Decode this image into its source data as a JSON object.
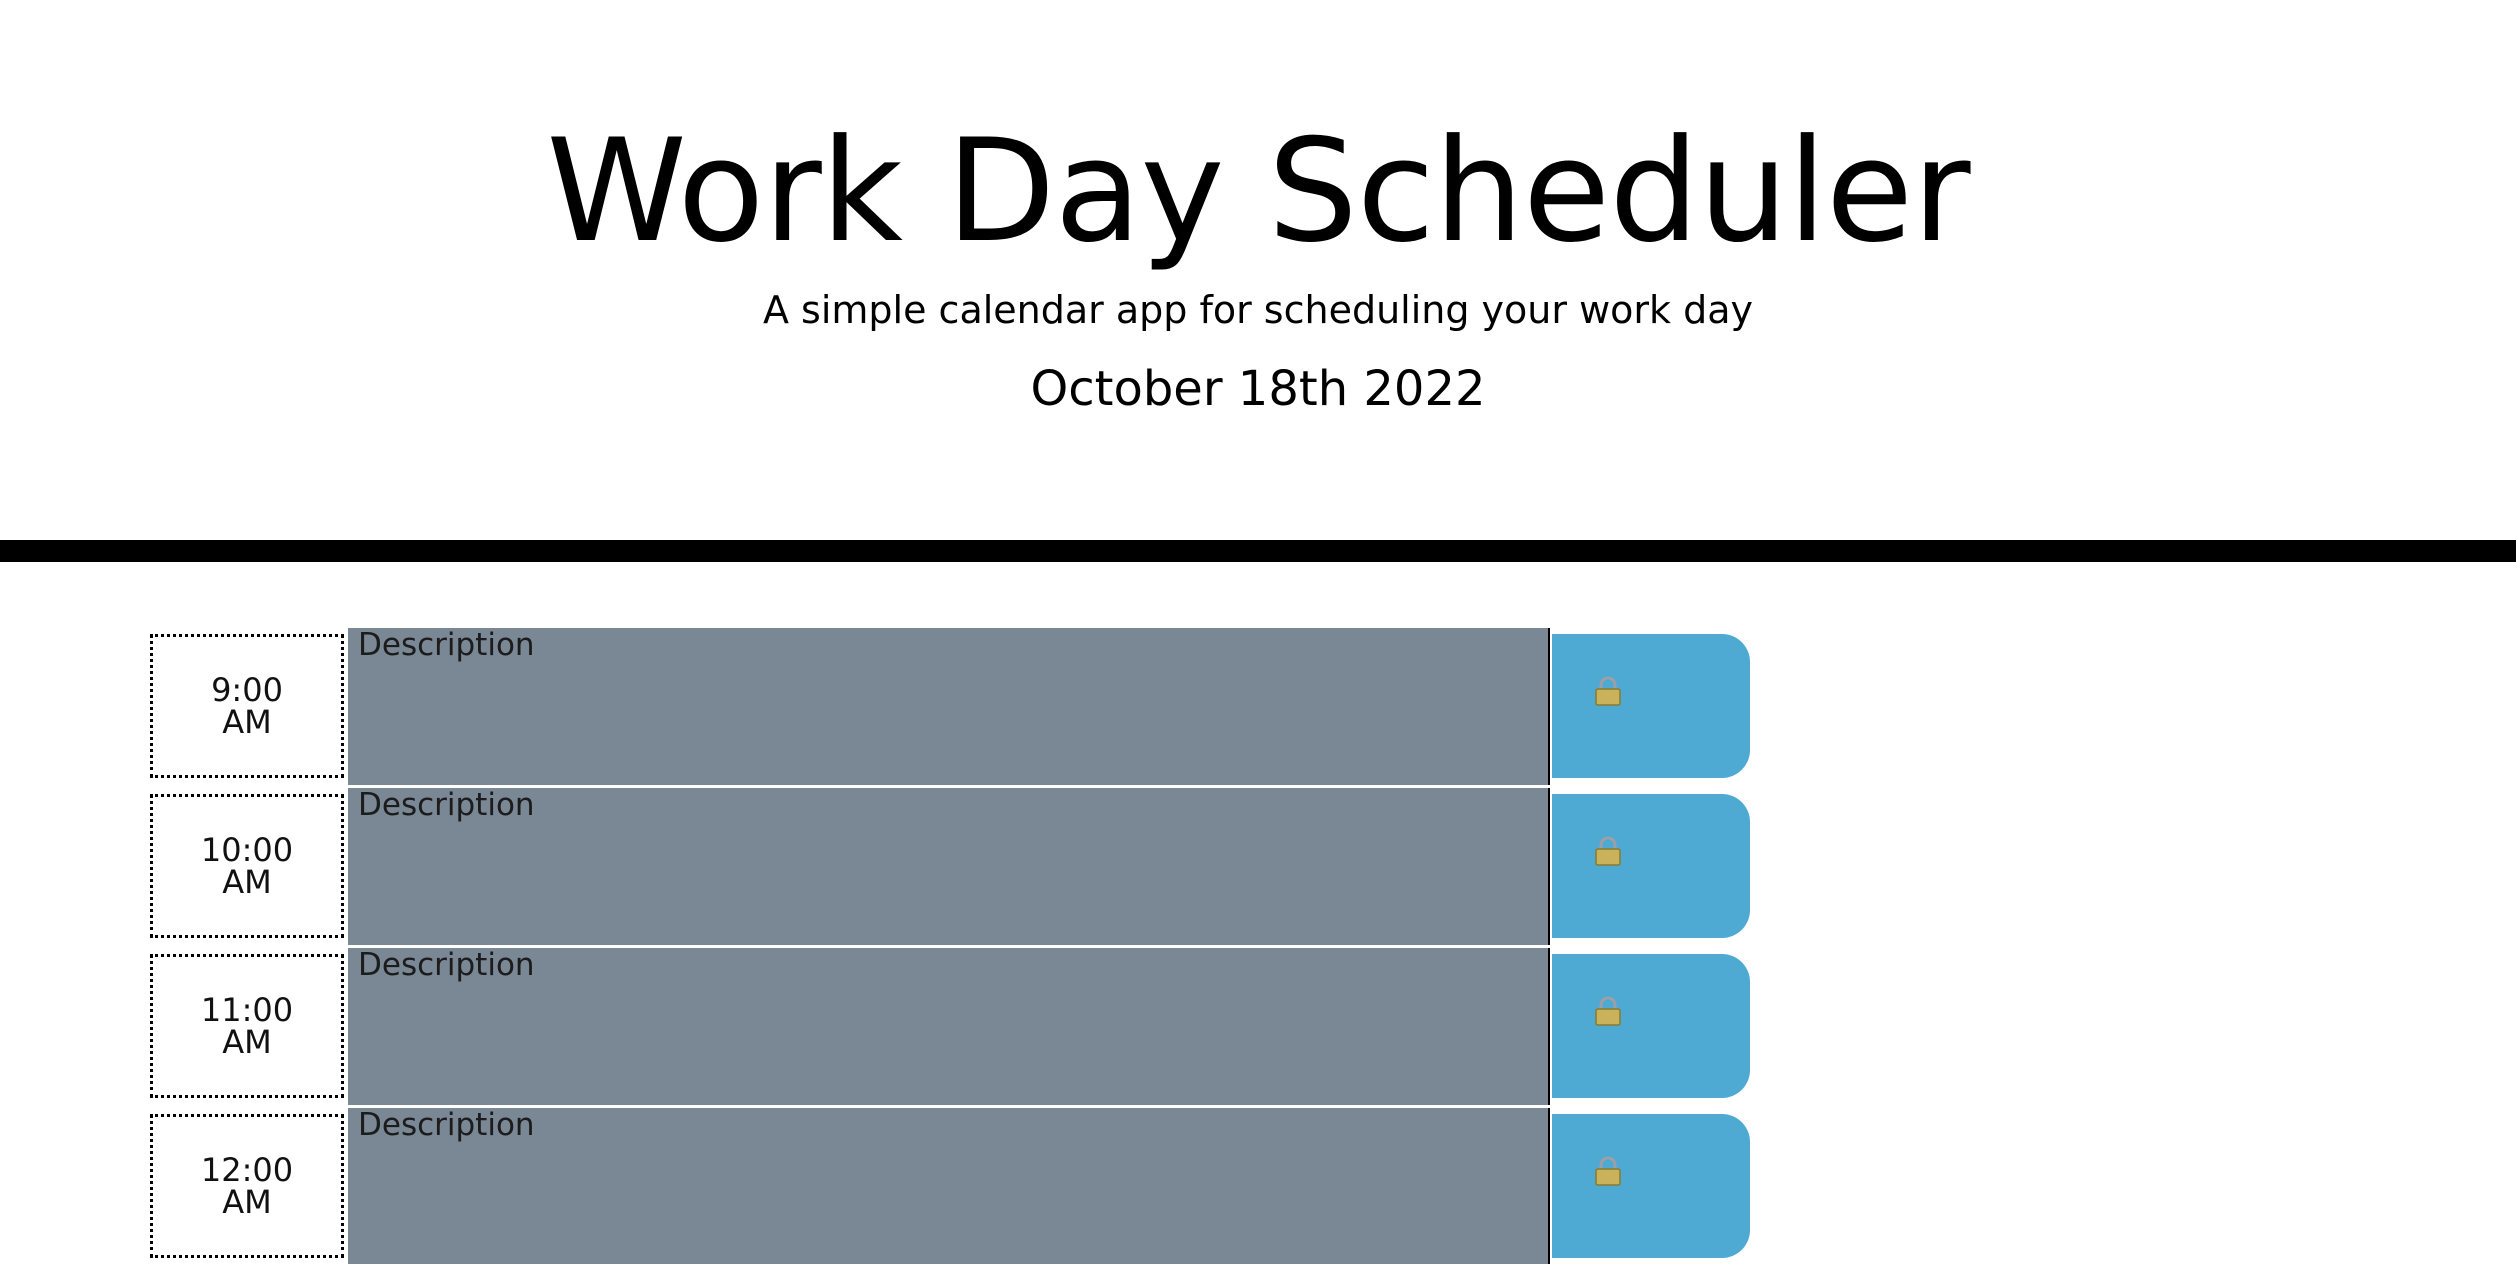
{
  "header": {
    "title": "Work Day Scheduler",
    "subtitle": "A simple calendar app for scheduling your work day",
    "date": "October 18th 2022"
  },
  "rows": [
    {
      "hour": "9:00 AM",
      "description": "",
      "placeholder": "Description",
      "save_icon": "lock-icon"
    },
    {
      "hour": "10:00 AM",
      "description": "",
      "placeholder": "Description",
      "save_icon": "lock-icon"
    },
    {
      "hour": "11:00 AM",
      "description": "",
      "placeholder": "Description",
      "save_icon": "lock-icon"
    },
    {
      "hour": "12:00 AM",
      "description": "",
      "placeholder": "Description",
      "save_icon": "lock-icon"
    }
  ],
  "colors": {
    "description_bg": "#7a8795",
    "save_button_bg": "#4eaad3",
    "divider": "#000000"
  }
}
